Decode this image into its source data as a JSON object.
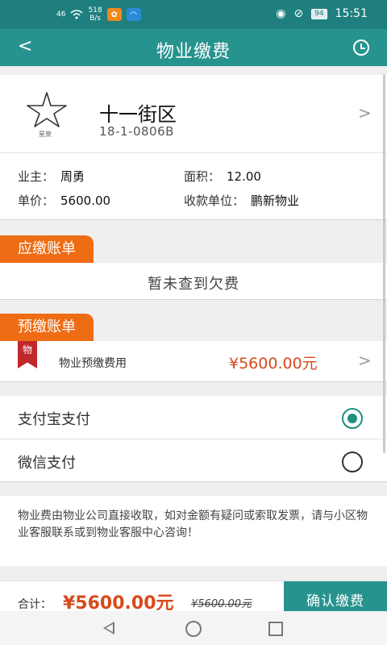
{
  "statusbar": {
    "signal": "46",
    "net_speed_value": "518",
    "net_speed_unit": "B/s",
    "battery": "94",
    "time": "15:51",
    "icons": [
      "signal-icon",
      "wifi-icon",
      "eye-icon",
      "mute-icon",
      "battery-icon"
    ]
  },
  "appbar": {
    "title": "物业缴费",
    "back_icon": "chevron-left-icon",
    "history_icon": "clock-icon"
  },
  "property": {
    "logo_text": "星泉",
    "community": "十一街区",
    "unit": "18-1-0806B"
  },
  "info": {
    "owner_label": "业主：",
    "owner_value": "周勇",
    "area_label": "面积：",
    "area_value": "12.00",
    "price_label": "单价：",
    "price_value": "5600.00",
    "payee_label": "收款单位：",
    "payee_value": "鹏新物业"
  },
  "owed": {
    "tag": "应缴账单",
    "empty_text": "暂未查到欠费"
  },
  "prepay": {
    "tag": "预缴账单",
    "ribbon_text": "物",
    "label": "物业预缴费用",
    "amount": "¥5600.00元"
  },
  "payment": {
    "options": [
      {
        "label": "支付宝支付",
        "selected": true
      },
      {
        "label": "微信支付",
        "selected": false
      }
    ],
    "accent_color": "#1f8f7f"
  },
  "notice": {
    "text": "物业费由物业公司直接收取，如对金额有疑问或索取发票，请与小区物业客服联系或到物业客服中心咨询！"
  },
  "bottom": {
    "total_label": "合计：",
    "total_amount": "¥5600.00元",
    "original_amount": "¥5600.00元",
    "confirm_label": "确认缴费"
  },
  "colors": {
    "primary": "#27938f",
    "status_bar": "#1f7f7f",
    "tag_orange": "#ee6c14",
    "price_red": "#d64a1b"
  }
}
